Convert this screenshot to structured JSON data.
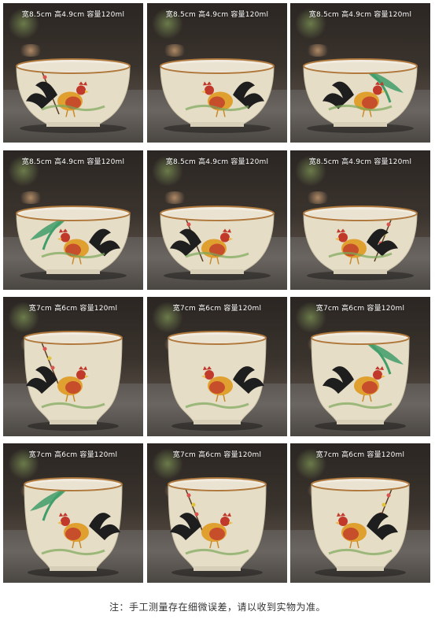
{
  "products": [
    {
      "caption": "宽8.5cm 高4.9cm 容量120ml",
      "shape": "wide",
      "variant": 1
    },
    {
      "caption": "宽8.5cm 高4.9cm 容量120ml",
      "shape": "wide",
      "variant": 2
    },
    {
      "caption": "宽8.5cm 高4.9cm 容量120ml",
      "shape": "wide",
      "variant": 3
    },
    {
      "caption": "宽8.5cm 高4.9cm 容量120ml",
      "shape": "wide",
      "variant": 4
    },
    {
      "caption": "宽8.5cm 高4.9cm 容量120ml",
      "shape": "wide",
      "variant": 5
    },
    {
      "caption": "宽8.5cm 高4.9cm 容量120ml",
      "shape": "wide",
      "variant": 6
    },
    {
      "caption": "宽7cm 高6cm 容量120ml",
      "shape": "tall",
      "variant": 1
    },
    {
      "caption": "宽7cm 高6cm 容量120ml",
      "shape": "tall",
      "variant": 2
    },
    {
      "caption": "宽7cm 高6cm 容量120ml",
      "shape": "tall",
      "variant": 3
    },
    {
      "caption": "宽7cm 高6cm 容量120ml",
      "shape": "tall",
      "variant": 4
    },
    {
      "caption": "宽7cm 高6cm 容量120ml",
      "shape": "tall",
      "variant": 5
    },
    {
      "caption": "宽7cm 高6cm 容量120ml",
      "shape": "tall",
      "variant": 6
    }
  ],
  "footer_note": "注：手工测量存在细微误差，请以收到实物为准。",
  "colors": {
    "glaze": "#e6ddc6",
    "rim": "#b07a3e",
    "rooster_red": "#c0392b",
    "tail_black": "#1e1e1e",
    "leaf_green": "#3f9e6a"
  }
}
